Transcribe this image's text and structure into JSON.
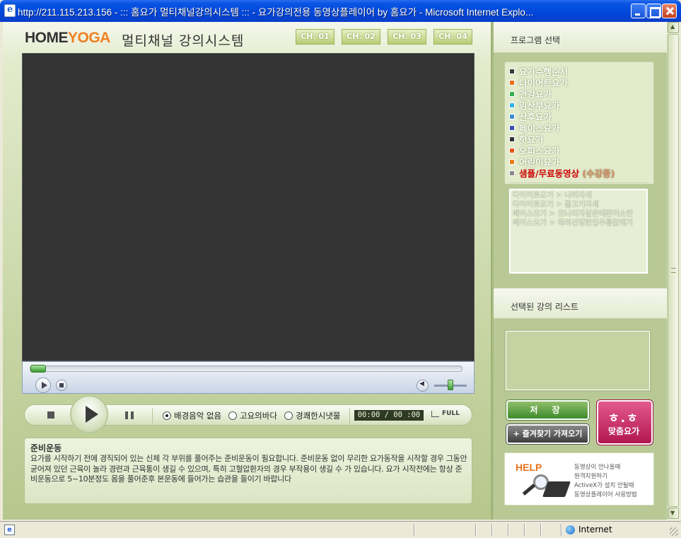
{
  "window": {
    "title": "http://211.115.213.156 - ::: 홈요가 멀티채널강의시스템 ::: - 요가강의전용 동영상플레이어 by 홈요가 - Microsoft Internet Explo..."
  },
  "header": {
    "logo_home": "HOME",
    "logo_yoga": "YOGA",
    "system_title": "멀티채널 강의시스템",
    "channels": [
      "CH. 01",
      "CH. 02",
      "CH. 03",
      "CH. 04"
    ]
  },
  "player": {
    "seek_progress": 0.0,
    "volume_level": 0.5,
    "bgm_options": [
      "배경음악 없음",
      "고요의바다",
      "경쾌한시냇물"
    ],
    "bgm_selected": "배경음악 없음",
    "time_display": "00:00 / 00 :00",
    "full_label": "FULL"
  },
  "description": {
    "title": "준비운동",
    "body": "요가를 시작하기 전에 경직되어 있는 신체 각 부위를 풀어주는 준비운동이 필요합니다. 준비운동 없이 무리한 요가동작을 시작할 경우 그동안 굳어져 있던 근육이 놀라 경련과 근육통이 생길 수 있으며, 특히 고혈압환자의 경우 부작용이 생길 수 가 있습니다. 요가 시작전에는 항상 준비운동으로 5~10분정도 몸을 풀어준후 본운동에 들어가는 습관을 들이기 바랍니다"
  },
  "sidebar": {
    "program_header": "프로그램 선택",
    "programs": [
      {
        "label": "요가수행순서",
        "color": "#3a3a3a"
      },
      {
        "label": "다이어트요가",
        "color": "#e8701a"
      },
      {
        "label": "건강요가",
        "color": "#34b04a"
      },
      {
        "label": "임산부요가",
        "color": "#29b6e8"
      },
      {
        "label": "산후요가",
        "color": "#3e8fd0"
      },
      {
        "label": "페이스요가",
        "color": "#3d4fb0"
      },
      {
        "label": "핫요가",
        "color": "#333333"
      },
      {
        "label": "오피스요가",
        "color": "#e65a1a"
      },
      {
        "label": "어린이요가",
        "color": "#e8801a"
      }
    ],
    "sample": {
      "label": "샘플/무료동영상",
      "sub": "(수강중)",
      "color": "#8a8a8a"
    },
    "lecture_items": [
      "다이어트요가 > 나비자세",
      "다이어트요가 > 물고기자세",
      "페이스요가 > 모나리자같은예쁜미소만",
      "페이스요가 > 목의선명한엽주름없애기"
    ],
    "selected_header": "선택된 강의 리스트",
    "save_label": "저 장",
    "fav_label": "+ 즐겨찾기 가져오기",
    "custom_face": "ㅎ.ㅎ",
    "custom_label": "맞춤요가",
    "help": {
      "title": "HELP",
      "lines": [
        "동영상이 안나올때",
        "원격지원하기",
        "ActiveX가 설치 안될때",
        "동영상플레이어 사용방법"
      ]
    }
  },
  "statusbar": {
    "zone": "Internet"
  }
}
